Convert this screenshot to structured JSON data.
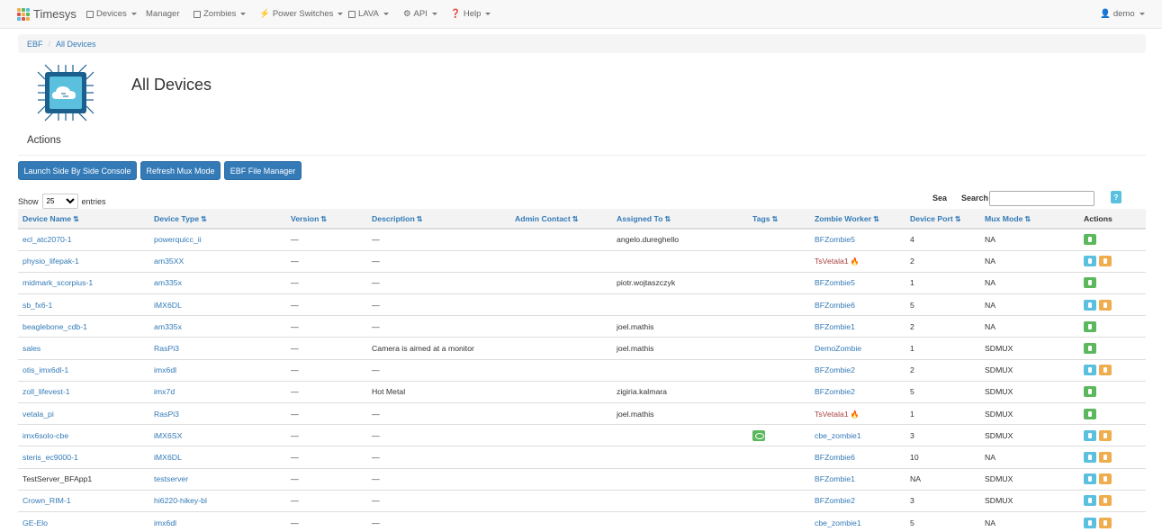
{
  "brand": {
    "name": "Timesys",
    "logo_colors": [
      "#f0ad4e",
      "#5cb85c",
      "#5bc0de",
      "#d9534f",
      "#f0ad4e",
      "#5cb85c",
      "#5bc0de",
      "#d9534f",
      "#f0ad4e"
    ]
  },
  "nav": {
    "devices": "Devices",
    "manager": "Manager",
    "zombies": "Zombies",
    "power": "Power Switches",
    "lava": "LAVA",
    "api": "API",
    "help": "Help",
    "user": "demo"
  },
  "breadcrumb": {
    "root": "EBF",
    "current": "All Devices"
  },
  "page_title": "All Devices",
  "actions_heading": "Actions",
  "buttons": {
    "side_console": "Launch Side By Side Console",
    "refresh_mux": "Refresh Mux Mode",
    "file_manager": "EBF File Manager"
  },
  "table_controls": {
    "show": "Show",
    "entries": "entries",
    "page_size": "25",
    "sea": "Sea",
    "search": "Search",
    "help": "?"
  },
  "columns": [
    "Device Name",
    "Device Type",
    "Version",
    "Description",
    "Admin Contact",
    "Assigned To",
    "Tags",
    "Zombie Worker",
    "Device Port",
    "Mux Mode",
    "Actions"
  ],
  "rows": [
    {
      "name": "ecl_atc2070-1",
      "type": "powerquicc_ii",
      "version": "—",
      "desc": "—",
      "admin": "",
      "assigned": "angelo.dureghello",
      "tag": false,
      "worker": "BFZombie5",
      "worker_red": false,
      "port": "4",
      "mux": "NA",
      "actions": [
        "g"
      ],
      "name_link": true
    },
    {
      "name": "physio_lifepak-1",
      "type": "am35XX",
      "version": "—",
      "desc": "—",
      "admin": "",
      "assigned": "",
      "tag": false,
      "worker": "TsVetala1",
      "worker_red": true,
      "port": "2",
      "mux": "NA",
      "actions": [
        "c",
        "o"
      ],
      "name_link": true
    },
    {
      "name": "midmark_scorpius-1",
      "type": "am335x",
      "version": "—",
      "desc": "—",
      "admin": "",
      "assigned": "piotr.wojtaszczyk",
      "tag": false,
      "worker": "BFZombie5",
      "worker_red": false,
      "port": "1",
      "mux": "NA",
      "actions": [
        "g"
      ],
      "name_link": true
    },
    {
      "name": "sb_fx6-1",
      "type": "iMX6DL",
      "version": "—",
      "desc": "—",
      "admin": "",
      "assigned": "",
      "tag": false,
      "worker": "BFZombie6",
      "worker_red": false,
      "port": "5",
      "mux": "NA",
      "actions": [
        "c",
        "o"
      ],
      "name_link": true
    },
    {
      "name": "beaglebone_cdb-1",
      "type": "am335x",
      "version": "—",
      "desc": "—",
      "admin": "",
      "assigned": "joel.mathis",
      "tag": false,
      "worker": "BFZombie1",
      "worker_red": false,
      "port": "2",
      "mux": "NA",
      "actions": [
        "g"
      ],
      "name_link": true
    },
    {
      "name": "sales",
      "type": "RasPi3",
      "version": "—",
      "desc": "Camera is aimed at a monitor",
      "admin": "",
      "assigned": "joel.mathis",
      "tag": false,
      "worker": "DemoZombie",
      "worker_red": false,
      "port": "1",
      "mux": "SDMUX",
      "actions": [
        "g"
      ],
      "name_link": true
    },
    {
      "name": "otis_imx6dl-1",
      "type": "imx6dl",
      "version": "—",
      "desc": "—",
      "admin": "",
      "assigned": "",
      "tag": false,
      "worker": "BFZombie2",
      "worker_red": false,
      "port": "2",
      "mux": "SDMUX",
      "actions": [
        "c",
        "o"
      ],
      "name_link": true
    },
    {
      "name": "zoll_lifevest-1",
      "type": "imx7d",
      "version": "—",
      "desc": "Hot Metal",
      "admin": "",
      "assigned": "zigiria.kalmara",
      "tag": false,
      "worker": "BFZombie2",
      "worker_red": false,
      "port": "5",
      "mux": "SDMUX",
      "actions": [
        "g"
      ],
      "name_link": true
    },
    {
      "name": "vetala_pi",
      "type": "RasPi3",
      "version": "—",
      "desc": "—",
      "admin": "",
      "assigned": "joel.mathis",
      "tag": false,
      "worker": "TsVetala1",
      "worker_red": true,
      "port": "1",
      "mux": "SDMUX",
      "actions": [
        "g"
      ],
      "name_link": true
    },
    {
      "name": "imx6solo-cbe",
      "type": "iMX6SX",
      "version": "—",
      "desc": "—",
      "admin": "",
      "assigned": "",
      "tag": true,
      "worker": "cbe_zombie1",
      "worker_red": false,
      "port": "3",
      "mux": "SDMUX",
      "actions": [
        "c",
        "o"
      ],
      "name_link": true
    },
    {
      "name": "steris_ec9000-1",
      "type": "iMX6DL",
      "version": "—",
      "desc": "—",
      "admin": "",
      "assigned": "",
      "tag": false,
      "worker": "BFZombie6",
      "worker_red": false,
      "port": "10",
      "mux": "NA",
      "actions": [
        "c",
        "o"
      ],
      "name_link": true
    },
    {
      "name": "TestServer_BFApp1",
      "type": "testserver",
      "version": "—",
      "desc": "—",
      "admin": "",
      "assigned": "",
      "tag": false,
      "worker": "BFZombie1",
      "worker_red": false,
      "port": "NA",
      "mux": "SDMUX",
      "actions": [
        "c",
        "o"
      ],
      "name_link": false
    },
    {
      "name": "Crown_RIM-1",
      "type": "hi6220-hikey-bl",
      "version": "—",
      "desc": "—",
      "admin": "",
      "assigned": "",
      "tag": false,
      "worker": "BFZombie2",
      "worker_red": false,
      "port": "3",
      "mux": "SDMUX",
      "actions": [
        "c",
        "o"
      ],
      "name_link": true
    },
    {
      "name": "GE-Elo",
      "type": "imx6dl",
      "version": "—",
      "desc": "—",
      "admin": "",
      "assigned": "",
      "tag": false,
      "worker": "cbe_zombie1",
      "worker_red": false,
      "port": "5",
      "mux": "NA",
      "actions": [
        "c",
        "o"
      ],
      "name_link": true
    }
  ]
}
